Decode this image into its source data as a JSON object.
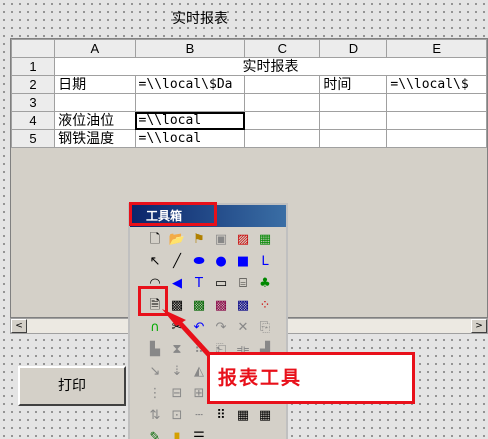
{
  "report": {
    "title": "实时报表",
    "columns": [
      "A",
      "B",
      "C",
      "D",
      "E"
    ],
    "rows": [
      {
        "num": "1",
        "merged_title": "实时报表"
      },
      {
        "num": "2",
        "cells": [
          "日期",
          "=\\\\local\\$Da",
          "",
          "时间",
          "=\\\\local\\$"
        ]
      },
      {
        "num": "3",
        "cells": [
          "",
          "",
          "",
          "",
          ""
        ]
      },
      {
        "num": "4",
        "cells": [
          "液位油位",
          "=\\\\local",
          "",
          "",
          ""
        ]
      },
      {
        "num": "5",
        "cells": [
          "钢铁温度",
          "=\\\\local",
          "",
          "",
          ""
        ]
      }
    ]
  },
  "scrollbar": {
    "left": "<",
    "right": ">"
  },
  "print_button": {
    "label": "打印"
  },
  "toolbox": {
    "title": "工具箱",
    "icons": [
      {
        "name": "new-page-icon",
        "glyph": "🗋",
        "color": "#000"
      },
      {
        "name": "open-icon",
        "glyph": "📂",
        "color": "#888"
      },
      {
        "name": "flag-icon",
        "glyph": "⚑",
        "color": "#b08000"
      },
      {
        "name": "save-icon",
        "glyph": "▣",
        "color": "#888"
      },
      {
        "name": "chart-icon",
        "glyph": "▨",
        "color": "#c00"
      },
      {
        "name": "table-icon",
        "glyph": "▦",
        "color": "#080"
      },
      {
        "name": "pointer-icon",
        "glyph": "↖",
        "color": "#000"
      },
      {
        "name": "line-icon",
        "glyph": "╱",
        "color": "#000"
      },
      {
        "name": "lens-icon",
        "glyph": "⬬",
        "color": "#00f"
      },
      {
        "name": "ellipse-icon",
        "glyph": "●",
        "color": "#00f"
      },
      {
        "name": "rectangle-icon",
        "glyph": "■",
        "color": "#00f"
      },
      {
        "name": "polyline-icon",
        "glyph": "ᒪ",
        "color": "#00f"
      },
      {
        "name": "arc-icon",
        "glyph": "◠",
        "color": "#000"
      },
      {
        "name": "sector-icon",
        "glyph": "◀",
        "color": "#00f"
      },
      {
        "name": "text-icon",
        "glyph": "T",
        "color": "#00f"
      },
      {
        "name": "rounded-rect-icon",
        "glyph": "▭",
        "color": "#000"
      },
      {
        "name": "cylinder-icon",
        "glyph": "⌸",
        "color": "#000"
      },
      {
        "name": "tree-icon",
        "glyph": "♣",
        "color": "#080"
      },
      {
        "name": "report-tool-icon",
        "glyph": "🗎",
        "color": "#000"
      },
      {
        "name": "trend-icon",
        "glyph": "▩",
        "color": "#000"
      },
      {
        "name": "alarm-icon",
        "glyph": "▩",
        "color": "#060"
      },
      {
        "name": "button-icon",
        "glyph": "▩",
        "color": "#804"
      },
      {
        "name": "bitmap-icon",
        "glyph": "▩",
        "color": "#008"
      },
      {
        "name": "scatter-icon",
        "glyph": "⁘",
        "color": "#c00"
      },
      {
        "name": "pipe-icon",
        "glyph": "∩",
        "color": "#0a0"
      },
      {
        "name": "cut-icon",
        "glyph": "✂",
        "color": "#000"
      },
      {
        "name": "undo-icon",
        "glyph": "↶",
        "color": "#00f"
      },
      {
        "name": "redo-icon",
        "glyph": "↷",
        "color": "#888"
      },
      {
        "name": "cross-icon",
        "glyph": "✕",
        "color": "#888"
      },
      {
        "name": "copy-icon",
        "glyph": "⎘",
        "color": "#888"
      },
      {
        "name": "align-left-icon",
        "glyph": "▙",
        "color": "#888"
      },
      {
        "name": "align-center-icon",
        "glyph": "⧗",
        "color": "#888"
      },
      {
        "name": "grid-dots-icon",
        "glyph": "⠿",
        "color": "#888"
      },
      {
        "name": "paste-icon",
        "glyph": "⎗",
        "color": "#888"
      },
      {
        "name": "mirror-icon",
        "glyph": "⟚",
        "color": "#888"
      },
      {
        "name": "align-right-icon",
        "glyph": "▟",
        "color": "#888"
      },
      {
        "name": "arrow-diag-icon",
        "glyph": "↘",
        "color": "#888"
      },
      {
        "name": "arrow-down-icon",
        "glyph": "⇣",
        "color": "#888"
      },
      {
        "name": "layer-icon",
        "glyph": "◭",
        "color": "#888"
      },
      {
        "name": "group-icon",
        "glyph": "⧉",
        "color": "#888"
      },
      {
        "name": "ungroup-icon",
        "glyph": "⧈",
        "color": "#888"
      },
      {
        "name": "rotate-icon",
        "glyph": "⟲",
        "color": "#888"
      },
      {
        "name": "distribute-icon",
        "glyph": "⋮",
        "color": "#888"
      },
      {
        "name": "same-width-icon",
        "glyph": "⊟",
        "color": "#888"
      },
      {
        "name": "same-height-icon",
        "glyph": "⊞",
        "color": "#888"
      },
      {
        "name": "bring-front-icon",
        "glyph": "▤",
        "color": "#888"
      },
      {
        "name": "send-back-icon",
        "glyph": "▥",
        "color": "#888"
      },
      {
        "name": "spacing-icon",
        "glyph": "⋯",
        "color": "#888"
      },
      {
        "name": "flip-icon",
        "glyph": "⇅",
        "color": "#888"
      },
      {
        "name": "lock-icon",
        "glyph": "⊡",
        "color": "#888"
      },
      {
        "name": "dotted-line-icon",
        "glyph": "┄",
        "color": "#888"
      },
      {
        "name": "dot-grid-icon",
        "glyph": "⠿",
        "color": "#000"
      },
      {
        "name": "color-grid-icon",
        "glyph": "▦",
        "color": "#000"
      },
      {
        "name": "palette-icon",
        "glyph": "▦",
        "color": "#000"
      },
      {
        "name": "brush-icon",
        "glyph": "✎",
        "color": "#060"
      },
      {
        "name": "color-bars-icon",
        "glyph": "▮",
        "color": "#d4a000"
      },
      {
        "name": "line-style-icon",
        "glyph": "☰",
        "color": "#000"
      }
    ]
  },
  "callout": {
    "label": "报表工具"
  }
}
